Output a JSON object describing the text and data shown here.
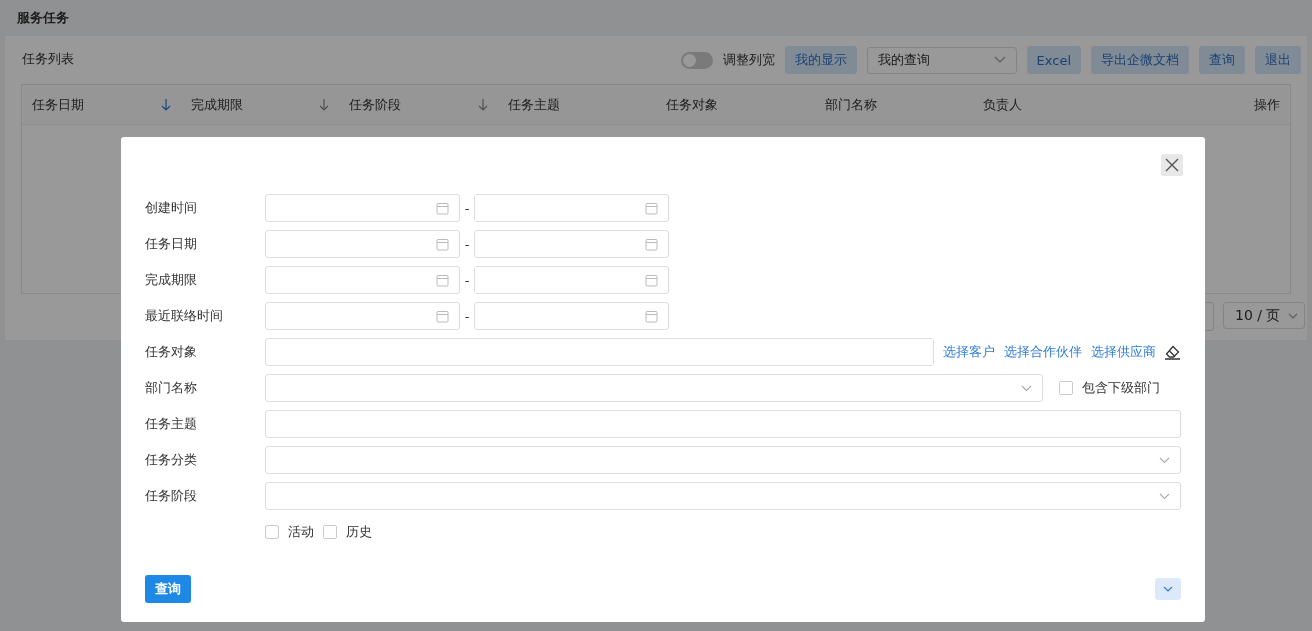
{
  "page": {
    "title": "服务任务"
  },
  "list": {
    "title": "任务列表"
  },
  "toolbar": {
    "toggle": {
      "label": "调整列宽",
      "on": false
    },
    "display_button": "我的显示",
    "saved_query": {
      "value": "我的查询"
    },
    "buttons": [
      "Excel",
      "导出企微文档",
      "查询",
      "退出"
    ]
  },
  "table": {
    "columns": [
      {
        "label": "任务日期",
        "sorted": true
      },
      {
        "label": "完成期限",
        "sorted": false
      },
      {
        "label": "任务阶段",
        "sorted": false
      },
      {
        "label": "任务主题"
      },
      {
        "label": "任务对象"
      },
      {
        "label": "部门名称"
      },
      {
        "label": "负责人"
      },
      {
        "label": "操作"
      }
    ]
  },
  "pagination": {
    "page_size": "10 / 页"
  },
  "dialog": {
    "fields": [
      {
        "label": "创建时间",
        "kind": "date_range",
        "separator": "-"
      },
      {
        "label": "任务日期",
        "kind": "date_range",
        "separator": "-"
      },
      {
        "label": "完成期限",
        "kind": "date_range",
        "separator": "-"
      },
      {
        "label": "最近联络时间",
        "kind": "date_range",
        "separator": "-"
      },
      {
        "label": "任务对象",
        "kind": "text",
        "links": [
          "选择客户",
          "选择合作伙伴",
          "选择供应商"
        ]
      },
      {
        "label": "部门名称",
        "kind": "select",
        "checkbox": {
          "label": "包含下级部门",
          "checked": false
        }
      },
      {
        "label": "任务主题",
        "kind": "text"
      },
      {
        "label": "任务分类",
        "kind": "select"
      },
      {
        "label": "任务阶段",
        "kind": "select"
      }
    ],
    "status_options": [
      {
        "label": "活动",
        "checked": false
      },
      {
        "label": "历史",
        "checked": false
      }
    ],
    "submit": "查询",
    "expanded": false
  }
}
